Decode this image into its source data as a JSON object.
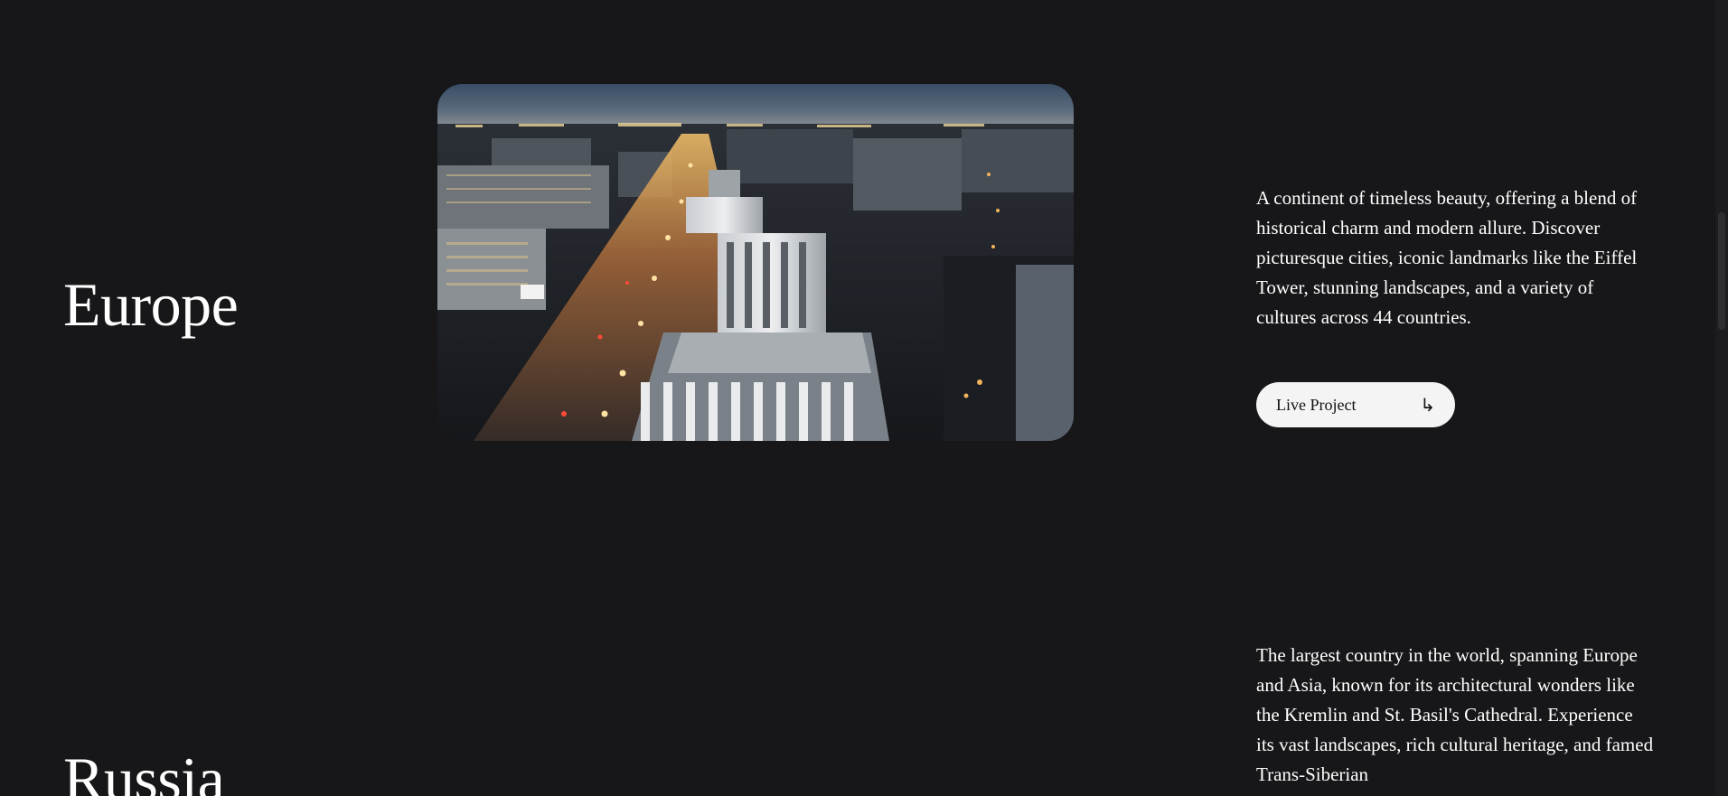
{
  "sections": [
    {
      "title": "Europe",
      "description": "A continent of timeless beauty, offering a blend of historical charm and modern allure. Discover picturesque cities, iconic landmarks like the Eiffel Tower, stunning landscapes, and a variety of cultures across 44 countries.",
      "button_label": "Live Project",
      "button_icon": "arrow-down-right-icon"
    },
    {
      "title": "Russia",
      "description": "The largest country in the world, spanning Europe and Asia, known for its architectural wonders like the Kremlin and St. Basil's Cathedral. Experience its vast landscapes, rich cultural heritage, and famed Trans-Siberian"
    }
  ],
  "colors": {
    "background": "#171719",
    "text": "#ffffff",
    "button_background": "#f4f4f4",
    "button_text": "#111111"
  }
}
